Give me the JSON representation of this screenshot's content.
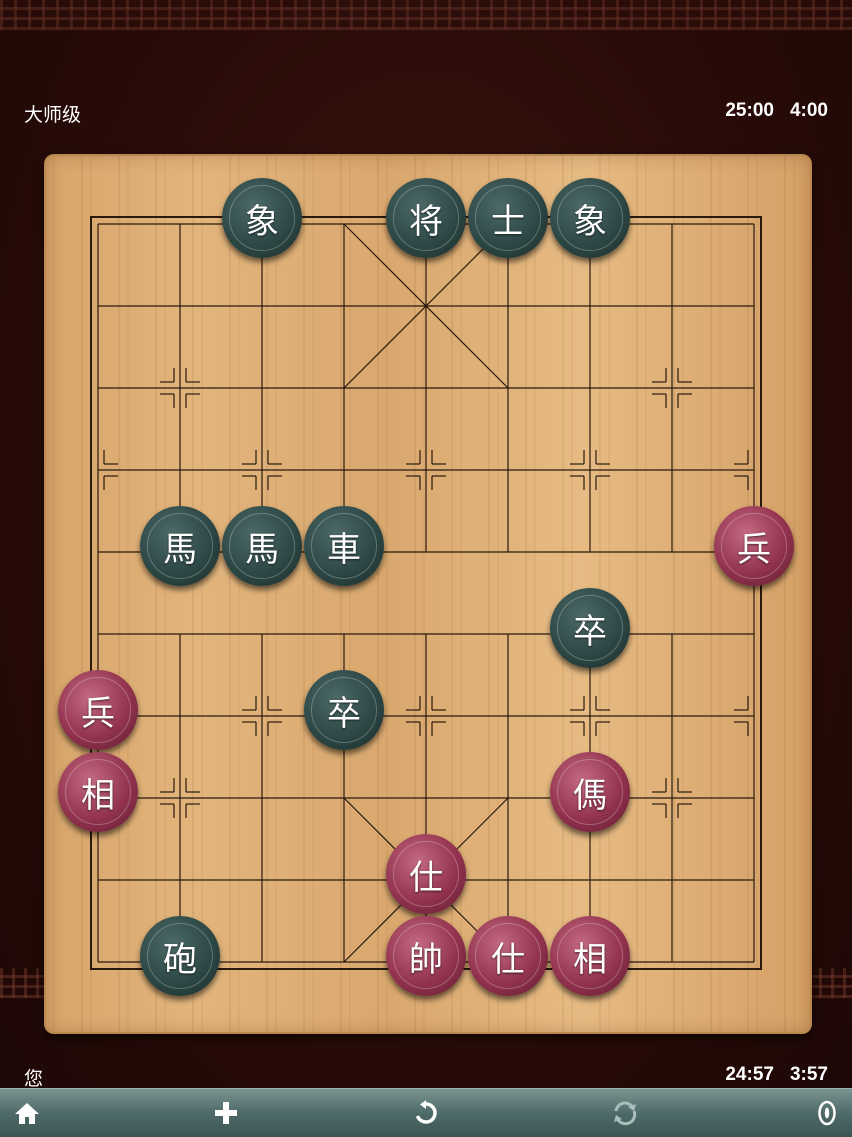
{
  "top_player": {
    "level": "大师级",
    "total_time": "25:00",
    "move_time": "4:00"
  },
  "bottom_player": {
    "name": "您",
    "total_time": "24:57",
    "move_time": "3:57"
  },
  "toolbar": {
    "home_icon": "home-icon",
    "new_game_icon": "plus-icon",
    "undo_icon": "undo-icon",
    "swap_icon": "swap-icon",
    "settings_icon": "settings-icon"
  },
  "colors": {
    "red_piece": "#93334f",
    "black_piece": "#2d4846",
    "toolbar": "#4f6b69"
  },
  "pieces": [
    {
      "char": "象",
      "side": "black",
      "file": 2,
      "rank": 0
    },
    {
      "char": "将",
      "side": "black",
      "file": 4,
      "rank": 0
    },
    {
      "char": "士",
      "side": "black",
      "file": 5,
      "rank": 0
    },
    {
      "char": "象",
      "side": "black",
      "file": 6,
      "rank": 0
    },
    {
      "char": "馬",
      "side": "black",
      "file": 1,
      "rank": 4
    },
    {
      "char": "馬",
      "side": "black",
      "file": 2,
      "rank": 4
    },
    {
      "char": "車",
      "side": "black",
      "file": 3,
      "rank": 4
    },
    {
      "char": "兵",
      "side": "red",
      "file": 8,
      "rank": 4
    },
    {
      "char": "卒",
      "side": "black",
      "file": 6,
      "rank": 5
    },
    {
      "char": "兵",
      "side": "red",
      "file": 0,
      "rank": 6
    },
    {
      "char": "卒",
      "side": "black",
      "file": 3,
      "rank": 6
    },
    {
      "char": "相",
      "side": "red",
      "file": 0,
      "rank": 7
    },
    {
      "char": "傌",
      "side": "red",
      "file": 6,
      "rank": 7
    },
    {
      "char": "仕",
      "side": "red",
      "file": 4,
      "rank": 8
    },
    {
      "char": "砲",
      "side": "black",
      "file": 1,
      "rank": 9
    },
    {
      "char": "帥",
      "side": "red",
      "file": 4,
      "rank": 9
    },
    {
      "char": "仕",
      "side": "red",
      "file": 5,
      "rank": 9
    },
    {
      "char": "相",
      "side": "red",
      "file": 6,
      "rank": 9
    }
  ]
}
